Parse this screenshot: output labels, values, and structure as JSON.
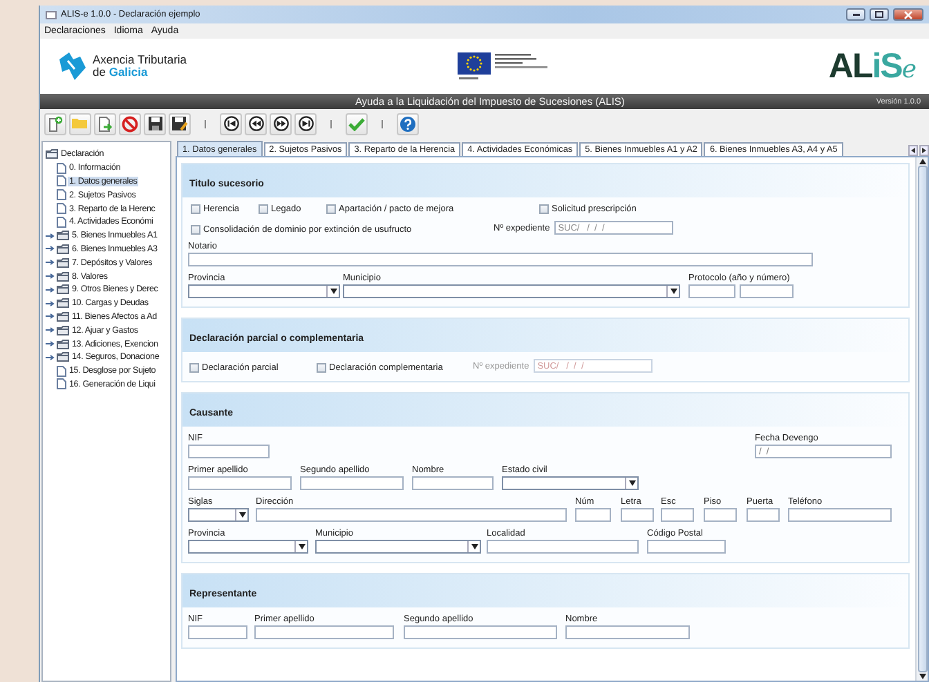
{
  "window": {
    "title": "ALIS-e 1.0.0 - Declaración ejemplo"
  },
  "menu": [
    "Declaraciones",
    "Idioma",
    "Ayuda"
  ],
  "header": {
    "agency_line1": "Axencia Tributaria",
    "agency_line2": "de **Galicia**",
    "logo": [
      "AL",
      "iS",
      "e"
    ]
  },
  "band": {
    "title": "Ayuda a la Liquidación del Impuesto de Sucesiones (ALIS)",
    "version": "Versión 1.0.0"
  },
  "tree": {
    "label": "Declaración",
    "expanded": true,
    "selected": false,
    "children": [
      {
        "label": "0. Información",
        "kind": "document",
        "selected": false
      },
      {
        "label": "1. Datos generales",
        "kind": "document",
        "selected": true
      },
      {
        "label": "2. Sujetos Pasivos",
        "kind": "document",
        "selected": false
      },
      {
        "label": "3. Reparto de la Herenc",
        "kind": "document",
        "selected": false
      },
      {
        "label": "4. Actividades Económi",
        "kind": "document",
        "selected": false
      },
      {
        "label": "5. Bienes Inmuebles A1",
        "kind": "folder",
        "expanded": false,
        "selected": false
      },
      {
        "label": "6. Bienes Inmuebles A3",
        "kind": "folder",
        "expanded": false,
        "selected": false
      },
      {
        "label": "7. Depósitos y Valores",
        "kind": "folder",
        "expanded": false,
        "selected": false
      },
      {
        "label": "8. Valores",
        "kind": "folder",
        "expanded": false,
        "selected": false
      },
      {
        "label": "9. Otros Bienes y Derec",
        "kind": "folder",
        "expanded": false,
        "selected": false
      },
      {
        "label": "10. Cargas y Deudas",
        "kind": "folder",
        "expanded": false,
        "selected": false
      },
      {
        "label": "11. Bienes Afectos a Ad",
        "kind": "folder",
        "expanded": false,
        "selected": false
      },
      {
        "label": "12. Ajuar y Gastos",
        "kind": "folder",
        "expanded": false,
        "selected": false
      },
      {
        "label": "13. Adiciones, Exencion",
        "kind": "folder",
        "expanded": false,
        "selected": false
      },
      {
        "label": "14. Seguros, Donacione",
        "kind": "folder",
        "expanded": false,
        "selected": false
      },
      {
        "label": "15. Desglose por Sujeto",
        "kind": "document",
        "selected": false
      },
      {
        "label": "16. Generación de Liqui",
        "kind": "document",
        "selected": false
      }
    ]
  },
  "tabs": [
    {
      "label": "1. Datos generales",
      "selected": true
    },
    {
      "label": "2. Sujetos Pasivos",
      "selected": false
    },
    {
      "label": "3. Reparto de la Herencia",
      "selected": false
    },
    {
      "label": "4. Actividades Económicas",
      "selected": false
    },
    {
      "label": "5. Bienes Inmuebles A1 y A2",
      "selected": false
    },
    {
      "label": "6. Bienes Inmuebles A3, A4 y A5",
      "selected": false
    }
  ],
  "sections": [
    {
      "title": "Titulo sucesorio",
      "rows": [
        [
          {
            "kind": "checkbox",
            "label": "Herencia",
            "checked": false
          },
          {
            "kind": "checkbox",
            "label": "Legado",
            "checked": false
          },
          {
            "kind": "checkbox",
            "label": "Apartación / pacto de mejora",
            "checked": false
          },
          {
            "kind": "checkbox",
            "label": "Solicitud prescripción",
            "checked": false
          }
        ],
        [
          {
            "kind": "checkbox",
            "label": "Consolidación de dominio por extinción de usufructo",
            "checked": false
          },
          "",
          "",
          {
            "kind": "inline",
            "label": "Nº expediente",
            "value": "SUC/   /  /  /",
            "disabled": false
          }
        ],
        [
          {
            "kind": "text",
            "label": "Notario"
          }
        ],
        [
          {
            "kind": "select",
            "label": "Provincia"
          },
          "",
          {
            "kind": "select",
            "label": "Municipio"
          },
          {
            "kind": "pair",
            "label": "Protocolo (año y número)"
          }
        ]
      ]
    },
    {
      "title": "Declaración parcial o complementaria",
      "rows": [
        [
          {
            "kind": "checkbox",
            "label": "Declaración parcial",
            "checked": false
          },
          {
            "kind": "checkbox",
            "label": "Declaración complementaria",
            "checked": false
          },
          {
            "kind": "inline",
            "label": "Nº expediente",
            "value": "SUC/   /  /  /",
            "disabled": true
          }
        ]
      ]
    },
    {
      "title": "Causante",
      "rows": [
        [
          {
            "kind": "text",
            "label": "NIF"
          },
          "",
          "",
          "",
          "",
          "",
          {
            "kind": "text",
            "label": "Fecha Devengo",
            "value": "/  /"
          }
        ],
        [
          {
            "kind": "text",
            "label": "Primer apellido"
          },
          {
            "kind": "text",
            "label": "Segundo apellido"
          },
          {
            "kind": "text",
            "label": "Nombre"
          },
          {
            "kind": "select",
            "label": "Estado civil"
          }
        ],
        [
          {
            "kind": "select",
            "label": "Siglas"
          },
          {
            "kind": "text",
            "label": "Dirección"
          },
          {
            "kind": "text",
            "label": "Núm"
          },
          {
            "kind": "text",
            "label": "Letra"
          },
          {
            "kind": "text",
            "label": "Esc"
          },
          {
            "kind": "text",
            "label": "Piso"
          },
          {
            "kind": "text",
            "label": "Puerta"
          },
          {
            "kind": "text",
            "label": "Teléfono"
          }
        ],
        [
          {
            "kind": "select",
            "label": "Provincia"
          },
          {
            "kind": "select",
            "label": "Municipio"
          },
          {
            "kind": "text",
            "label": "Localidad"
          },
          "",
          {
            "kind": "text",
            "label": "Código Postal"
          }
        ]
      ]
    },
    {
      "title": "Representante",
      "rows": [
        [
          {
            "kind": "text",
            "label": "NIF"
          },
          {
            "kind": "text",
            "label": "Primer apellido"
          },
          {
            "kind": "text",
            "label": "Segundo apellido"
          },
          {
            "kind": "text",
            "label": "Nombre"
          }
        ]
      ]
    }
  ]
}
